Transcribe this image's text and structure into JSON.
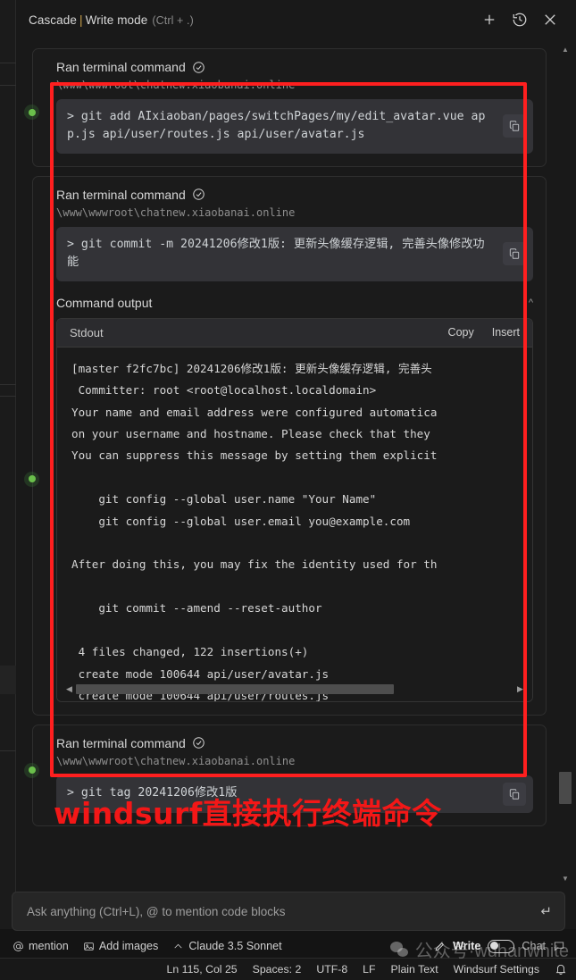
{
  "header": {
    "title_app": "Cascade",
    "separator": "|",
    "mode": "Write mode",
    "shortcut_hint": "(Ctrl + .)",
    "new_icon": "plus-icon",
    "history_icon": "history-clock-icon",
    "close_icon": "close-icon"
  },
  "steps": [
    {
      "label": "Ran terminal command",
      "cwd": "\\www\\wwwroot\\chatnew.xiaobanai.online",
      "command": "> git add AIxiaoban/pages/switchPages/my/edit_avatar.vue app.js api/user/routes.js api/user/avatar.js",
      "copy_label": "copy-icon"
    },
    {
      "label": "Ran terminal command",
      "cwd": "\\www\\wwwroot\\chatnew.xiaobanai.online",
      "command": "> git commit -m 20241206修改1版: 更新头像缓存逻辑, 完善头像修改功能",
      "copy_label": "copy-icon"
    },
    {
      "label": "Ran terminal command",
      "cwd": "\\www\\wwwroot\\chatnew.xiaobanai.online",
      "command": "> git tag 20241206修改1版",
      "copy_label": "copy-icon"
    }
  ],
  "command_output": {
    "title": "Command output",
    "stdout_label": "Stdout",
    "copy_label": "Copy",
    "insert_label": "Insert",
    "text": "[master f2fc7bc] 20241206修改1版: 更新头像缓存逻辑, 完善头\n Committer: root <root@localhost.localdomain>\nYour name and email address were configured automatica\non your username and hostname. Please check that they \nYou can suppress this message by setting them explicit\n\n    git config --global user.name \"Your Name\"\n    git config --global user.email you@example.com\n\nAfter doing this, you may fix the identity used for th\n\n    git commit --amend --reset-author\n\n 4 files changed, 122 insertions(+)\n create mode 100644 api/user/avatar.js\n create mode 100644 api/user/routes.js"
  },
  "annotation": {
    "text": "windsurf直接执行终端命令",
    "color": "#f31717"
  },
  "input": {
    "placeholder": "Ask anything (Ctrl+L), @ to mention code blocks",
    "value": "",
    "submit_icon": "enter-return-icon"
  },
  "toolbar": {
    "mention_label": "mention",
    "mention_icon": "at-sign-icon",
    "add_images_label": "Add images",
    "add_images_icon": "image-icon",
    "model_label": "Claude 3.5 Sonnet",
    "model_icon": "chevron-up-icon",
    "write_label": "Write",
    "chat_label": "Chat",
    "write_icon": "pencil-icon",
    "chat_icon": "speech-bubble-icon"
  },
  "statusbar": {
    "cursor_position": "Ln 115, Col 25",
    "indentation": "Spaces: 2",
    "encoding": "UTF-8",
    "line_ending": "LF",
    "language": "Plain Text",
    "settings": "Windsurf Settings",
    "bell_icon": "bell-dot-icon"
  },
  "watermark": {
    "text": "公众号·wuhanwhite",
    "icon": "wechat-icon"
  }
}
